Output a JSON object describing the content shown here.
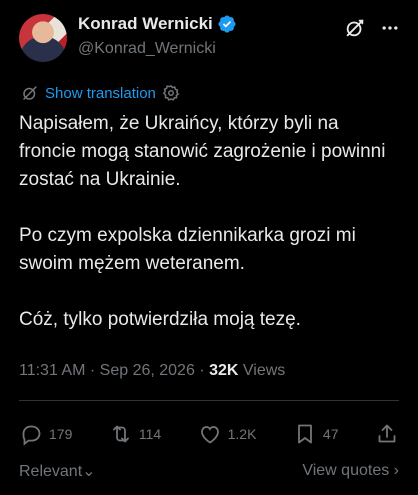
{
  "author": {
    "name": "Konrad Wernicki",
    "handle": "@Konrad_Wernicki",
    "verified": true
  },
  "translate": {
    "label": "Show translation"
  },
  "tweet": {
    "paragraphs": [
      "Napisałem, że Ukraińcy, którzy byli na froncie mogą stanowić zagrożenie i powinni zostać na Ukrainie.",
      "Po czym expolska dziennikarka grozi mi swoim mężem weteranem.",
      "Cóż, tylko potwierdziła moją tezę."
    ]
  },
  "meta": {
    "time": "11:31 AM",
    "separator1": "·",
    "date": "Sep 26, 2026",
    "separator2": "·",
    "views_count": "32K",
    "views_label": "Views"
  },
  "actions": {
    "replies": "179",
    "reposts": "114",
    "likes": "1.2K",
    "bookmarks": "47"
  },
  "footer": {
    "relevant": "Relevant",
    "view_quotes": "View quotes"
  },
  "colors": {
    "background": "#000000",
    "text": "#e7e9ea",
    "muted": "#71767b",
    "accent": "#1d9bf0",
    "divider": "#2f3336"
  }
}
